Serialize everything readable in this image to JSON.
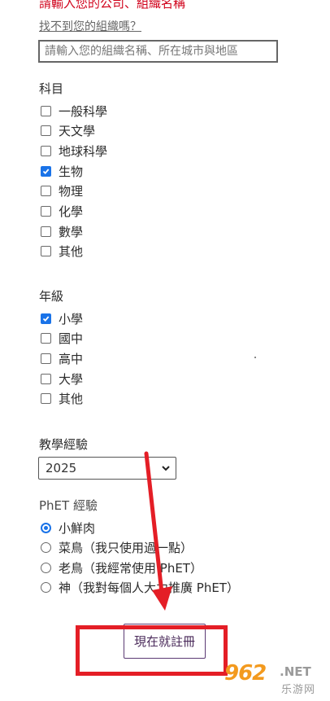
{
  "org": {
    "error_text": "請輸入您的公司、組織名稱",
    "help_link": "找不到您的組織嗎？",
    "input_placeholder": "請輸入您的組織名稱、所在城市與地區",
    "input_value": ""
  },
  "subjects": {
    "title": "科目",
    "options": [
      {
        "label": "一般科學",
        "checked": false
      },
      {
        "label": "天文學",
        "checked": false
      },
      {
        "label": "地球科學",
        "checked": false
      },
      {
        "label": "生物",
        "checked": true
      },
      {
        "label": "物理",
        "checked": false
      },
      {
        "label": "化學",
        "checked": false
      },
      {
        "label": "數學",
        "checked": false
      },
      {
        "label": "其他",
        "checked": false
      }
    ]
  },
  "grades": {
    "title": "年級",
    "options": [
      {
        "label": "小學",
        "checked": true
      },
      {
        "label": "國中",
        "checked": false
      },
      {
        "label": "高中",
        "checked": false
      },
      {
        "label": "大學",
        "checked": false
      },
      {
        "label": "其他",
        "checked": false
      }
    ]
  },
  "experience": {
    "title": "教學經驗",
    "selected": "2025"
  },
  "phet": {
    "title": "PhET 經驗",
    "options": [
      {
        "label": "小鮮肉",
        "checked": true
      },
      {
        "label": "菜鳥（我只使用過一點）",
        "checked": false
      },
      {
        "label": "老鳥（我經常使用 PhET）",
        "checked": false
      },
      {
        "label": "神（我對每個人大力推廣 PhET）",
        "checked": false
      }
    ]
  },
  "submit": {
    "label": "現在就註冊"
  },
  "annotation": {
    "color": "#e41e26"
  },
  "watermark": {
    "main": "962",
    "net": ".NET",
    "sub": "乐游网"
  },
  "colors": {
    "error": "#d0021b",
    "accent": "#1a73e8",
    "button_border": "#5b3a73"
  }
}
